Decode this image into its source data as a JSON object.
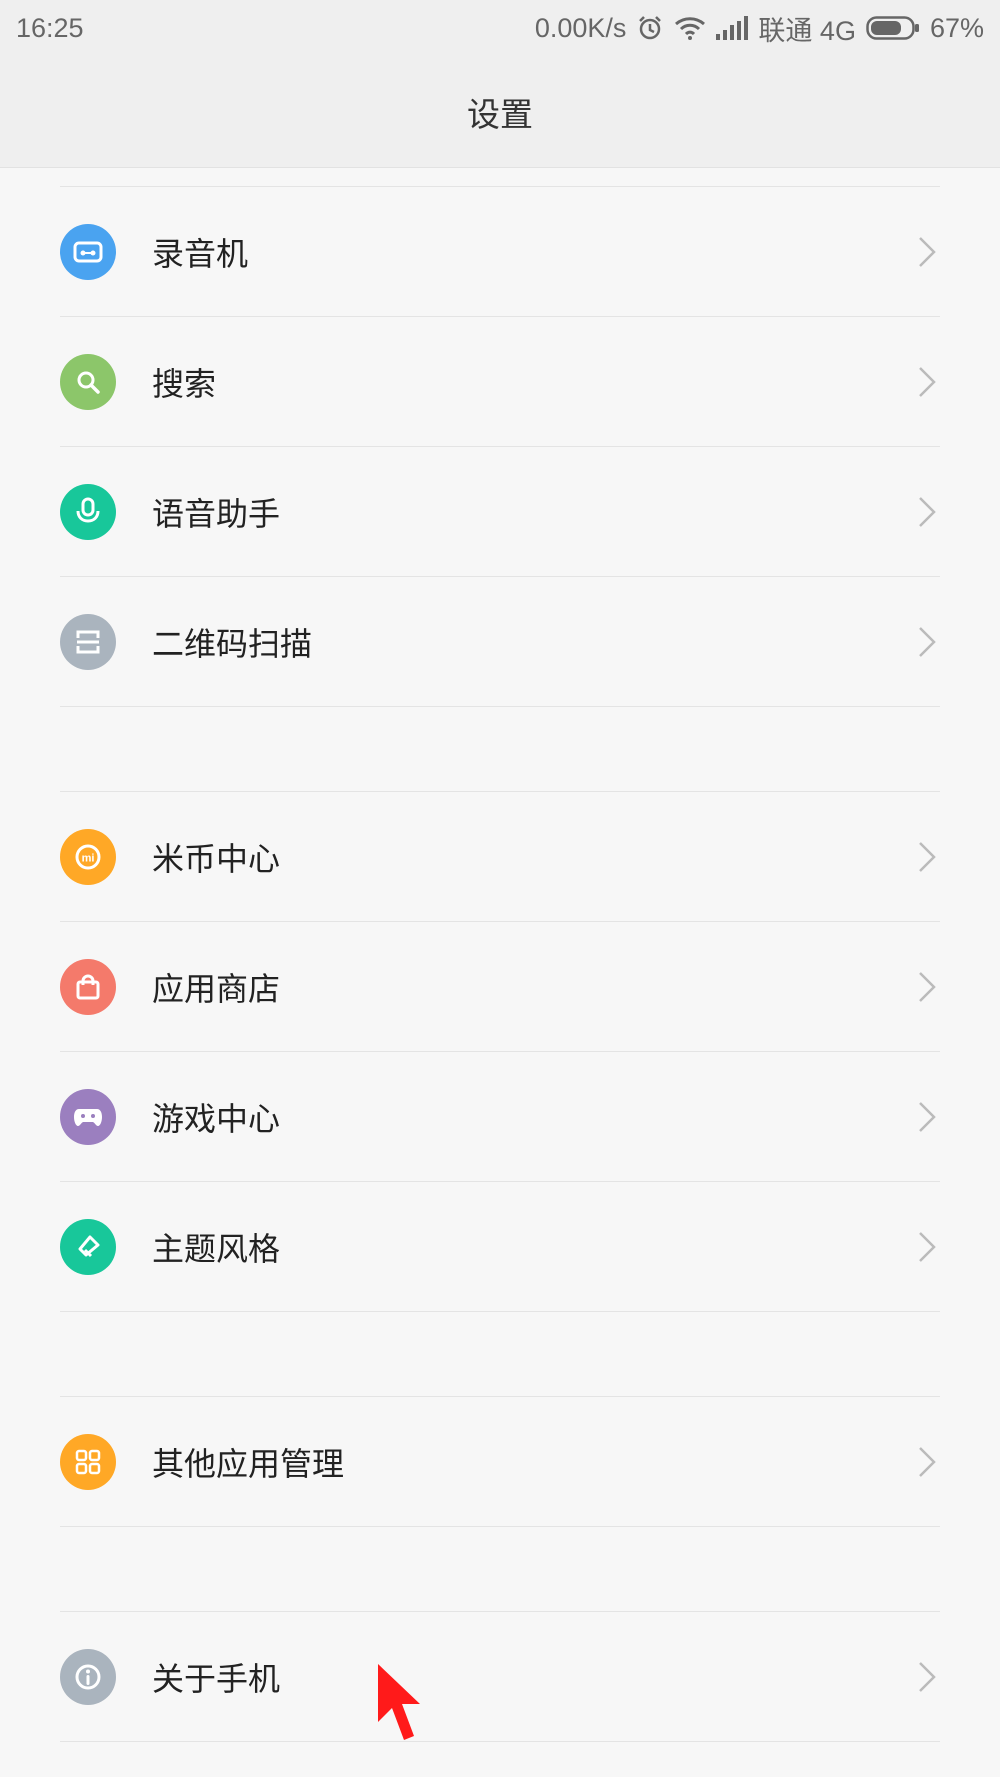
{
  "status_bar": {
    "time": "16:25",
    "speed": "0.00K/s",
    "carrier": "联通 4G",
    "battery": "67%",
    "icons": [
      "alarm-icon",
      "wifi-icon",
      "signal-icon",
      "battery-icon"
    ]
  },
  "header": {
    "title": "设置"
  },
  "sections": [
    {
      "items": [
        {
          "label": "录音机",
          "icon": "recorder-icon",
          "color": "#4aa3f0"
        },
        {
          "label": "搜索",
          "icon": "search-icon",
          "color": "#8cc66a"
        },
        {
          "label": "语音助手",
          "icon": "mic-icon",
          "color": "#18c79a"
        },
        {
          "label": "二维码扫描",
          "icon": "scan-icon",
          "color": "#aab4be"
        }
      ]
    },
    {
      "items": [
        {
          "label": "米币中心",
          "icon": "mi-coin-icon",
          "color": "#ffa826"
        },
        {
          "label": "应用商店",
          "icon": "shopping-bag-icon",
          "color": "#f47a6b"
        },
        {
          "label": "游戏中心",
          "icon": "gamepad-icon",
          "color": "#9b7fbf"
        },
        {
          "label": "主题风格",
          "icon": "brush-icon",
          "color": "#18c79a"
        }
      ]
    },
    {
      "items": [
        {
          "label": "其他应用管理",
          "icon": "apps-grid-icon",
          "color": "#ffa826"
        }
      ]
    },
    {
      "items": [
        {
          "label": "关于手机",
          "icon": "info-icon",
          "color": "#aab4be"
        }
      ]
    }
  ]
}
